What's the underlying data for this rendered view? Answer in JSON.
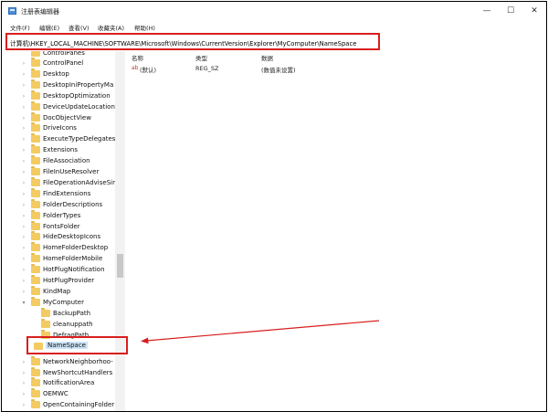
{
  "window": {
    "title": "注册表编辑器",
    "buttons": {
      "minimize": "—",
      "maximize": "☐",
      "close": "✕"
    }
  },
  "menu": [
    "文件(F)",
    "编辑(E)",
    "查看(V)",
    "收藏夹(A)",
    "帮助(H)"
  ],
  "address": "计算机\\HKEY_LOCAL_MACHINE\\SOFTWARE\\Microsoft\\Windows\\CurrentVersion\\Explorer\\MyComputer\\NameSpace",
  "tree": {
    "top_partial": "ControlPanes",
    "items": [
      "ControlPanel",
      "Desktop",
      "DesktopIniPropertyMa",
      "DesktopOptimization",
      "DeviceUpdateLocation",
      "DocObjectView",
      "DriveIcons",
      "ExecuteTypeDelegates",
      "Extensions",
      "FileAssociation",
      "FileInUseResolver",
      "FileOperationAdviseSir",
      "FindExtensions",
      "FolderDescriptions",
      "FolderTypes",
      "FontsFolder",
      "HideDesktopIcons",
      "HomeFolderDesktop",
      "HomeFolderMobile",
      "HotPlugNotification",
      "HotPlugProvider",
      "KindMap",
      "MyComputer"
    ],
    "subitems": [
      "BackupPath",
      "cleanuppath",
      "DefragPath"
    ],
    "selected": "NameSpace",
    "after_items": [
      "NetworkNeighborhoo-",
      "NewShortcutHandlers",
      "NotificationArea",
      "OEMWC",
      "OpenContainingFolder"
    ]
  },
  "values": {
    "headers": {
      "name": "名称",
      "type": "类型",
      "data": "数据"
    },
    "rows": [
      {
        "name": "(默认)",
        "type": "REG_SZ",
        "data": "(数值未设置)"
      }
    ],
    "ab_icon": "ab"
  },
  "colors": {
    "highlight": "#d81e1e",
    "folder": "#f3cb62",
    "selection": "#cce4f7"
  }
}
